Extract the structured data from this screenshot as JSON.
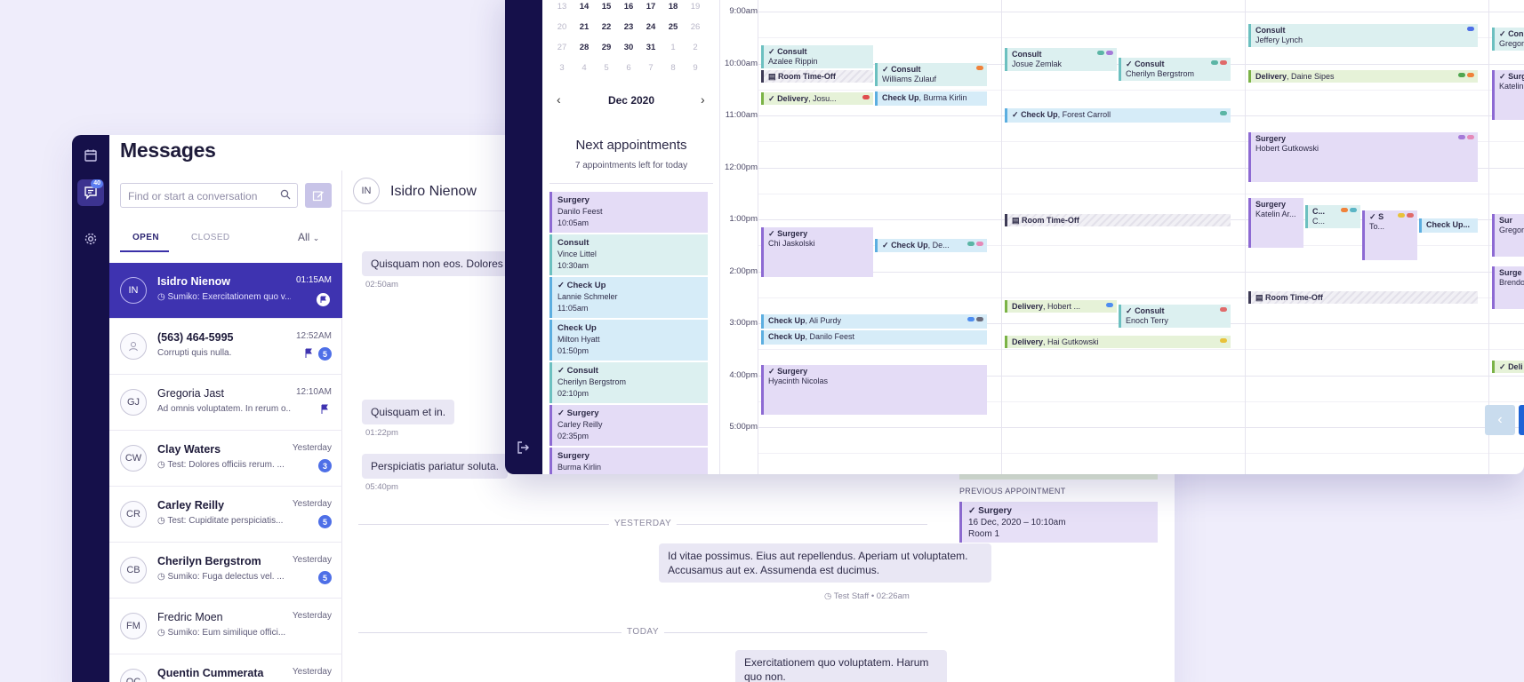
{
  "messages": {
    "title": "Messages",
    "rail_badge": "40",
    "search_placeholder": "Find or start a conversation",
    "tabs": {
      "open": "OPEN",
      "closed": "CLOSED",
      "filter": "All"
    },
    "conversations": [
      {
        "initials": "IN",
        "name": "Isidro Nienow",
        "preview": "Sumiko: Exercitationem quo v...",
        "time": "01:15AM"
      },
      {
        "initials": "",
        "name": "(563) 464-5995",
        "preview": "Corrupti quis nulla.",
        "time": "12:52AM",
        "badge": "5"
      },
      {
        "initials": "GJ",
        "name": "Gregoria Jast",
        "preview": "Ad omnis voluptatem. In rerum o...",
        "time": "12:10AM"
      },
      {
        "initials": "CW",
        "name": "Clay Waters",
        "preview": "Test: Dolores officiis rerum. ...",
        "time": "Yesterday",
        "badge": "3"
      },
      {
        "initials": "CR",
        "name": "Carley Reilly",
        "preview": "Test: Cupiditate perspiciatis...",
        "time": "Yesterday",
        "badge": "5"
      },
      {
        "initials": "CB",
        "name": "Cherilyn Bergstrom",
        "preview": "Sumiko: Fuga delectus vel. ...",
        "time": "Yesterday",
        "badge": "5"
      },
      {
        "initials": "FM",
        "name": "Fredric Moen",
        "preview": "Sumiko: Eum similique offici...",
        "time": "Yesterday"
      },
      {
        "initials": "QC",
        "name": "Quentin Cummerata",
        "preview": "",
        "time": "Yesterday"
      }
    ],
    "chat": {
      "initials": "IN",
      "name": "Isidro Nienow",
      "bubbles": [
        {
          "text": "Quisquam non eos. Dolores",
          "time": "02:50am"
        },
        {
          "text": "Quisquam et in.",
          "time": "01:22pm"
        },
        {
          "text": "Perspiciatis pariatur soluta.",
          "time": "05:40pm"
        }
      ],
      "sep_yesterday": "YESTERDAY",
      "outgoing1": "Id vitae possimus. Eius aut repellendus. Aperiam ut voluptatem. Accusamus aut ex. Assumenda est ducimus.",
      "outgoing1_meta": "Test Staff • 02:26am",
      "sep_today": "TODAY",
      "outgoing2": "Exercitationem quo voluptatem. Harum quo non."
    },
    "previous_appointment": {
      "label": "PREVIOUS APPOINTMENT",
      "type": "Surgery",
      "when": "16 Dec, 2020 – 10:10am",
      "room": "Room 1"
    }
  },
  "calendar": {
    "mini_rows": [
      [
        "13",
        "14",
        "15",
        "16",
        "17",
        "18",
        "19"
      ],
      [
        "20",
        "21",
        "22",
        "23",
        "24",
        "25",
        "26"
      ],
      [
        "27",
        "28",
        "29",
        "30",
        "31",
        "1",
        "2"
      ],
      [
        "3",
        "4",
        "5",
        "6",
        "7",
        "8",
        "9"
      ]
    ],
    "month": "Dec 2020",
    "next_title": "Next appointments",
    "next_sub": "7 appointments left for today",
    "side_appts": [
      {
        "type": "Surgery",
        "name": "Danilo Feest",
        "time": "10:05am",
        "kind": "surgery",
        "check": false
      },
      {
        "type": "Consult",
        "name": "Vince Littel",
        "time": "10:30am",
        "kind": "consult",
        "check": false
      },
      {
        "type": "Check Up",
        "name": "Lannie Schmeler",
        "time": "11:05am",
        "kind": "checkup",
        "check": true
      },
      {
        "type": "Check Up",
        "name": "Milton Hyatt",
        "time": "01:50pm",
        "kind": "checkup",
        "check": false
      },
      {
        "type": "Consult",
        "name": "Cherilyn Bergstrom",
        "time": "02:10pm",
        "kind": "consult",
        "check": true
      },
      {
        "type": "Surgery",
        "name": "Carley Reilly",
        "time": "02:35pm",
        "kind": "surgery",
        "check": true
      },
      {
        "type": "Surgery",
        "name": "Burma Kirlin",
        "time": "",
        "kind": "surgery",
        "check": false
      }
    ],
    "hours": [
      "9:00am",
      "10:00am",
      "11:00am",
      "12:00pm",
      "1:00pm",
      "2:00pm",
      "3:00pm",
      "4:00pm",
      "5:00pm"
    ],
    "events": {
      "e1_t": "Consult",
      "e1_n": "Azalee Rippin",
      "e2_t": "Room Time-Off",
      "e3_t": "Delivery",
      "e3_n": ", Josu...",
      "e4_t": "Consult",
      "e4_n": "Williams Zulauf",
      "e5_t": "Check Up",
      "e5_n": ", Burma Kirlin",
      "e6_t": "Consult",
      "e6_n": "Josue Zemlak",
      "e7_t": "Consult",
      "e7_n": "Cherilyn Bergstrom",
      "e8_t": "Check Up",
      "e8_n": ", Forest Carroll",
      "e9_t": "Consult",
      "e9_n": "Jeffery Lynch",
      "e10_t": "Delivery",
      "e10_n": ", Daine Sipes",
      "e11_t": "Surgery",
      "e11_n": "Hobert Gutkowski",
      "e12_t": "Surgery",
      "e12_n": "Chi Jaskolski",
      "e13_t": "Check Up",
      "e13_n": ", De...",
      "e14_t": "Room Time-Off",
      "e15_t": "Surgery",
      "e15_n": "Katelin Ar...",
      "e16_t": "C...",
      "e16_n": "C...",
      "e17_t": "S",
      "e17_n": "To...",
      "e18_t": "Check Up...",
      "e19_t": "Check Up",
      "e19_n": ", Ali Purdy",
      "e20_t": "Check Up",
      "e20_n": ", Danilo Feest",
      "e21_t": "Delivery",
      "e21_n": ", Hobert ...",
      "e22_t": "Consult",
      "e22_n": "Enoch Terry",
      "e23_t": "Delivery",
      "e23_n": ", Hai Gutkowski",
      "e24_t": "Room Time-Off",
      "e25_t": "Surgery",
      "e25_n": "Hyacinth Nicolas",
      "x1_t": "Con",
      "x1_n": "Gregor",
      "x2_t": "Surg",
      "x2_n": "Katelin",
      "x3_t": "Sur",
      "x3_n": "Gregor",
      "x4_t": "Surge",
      "x4_n": "Brendo",
      "x5_t": "Deli"
    }
  }
}
